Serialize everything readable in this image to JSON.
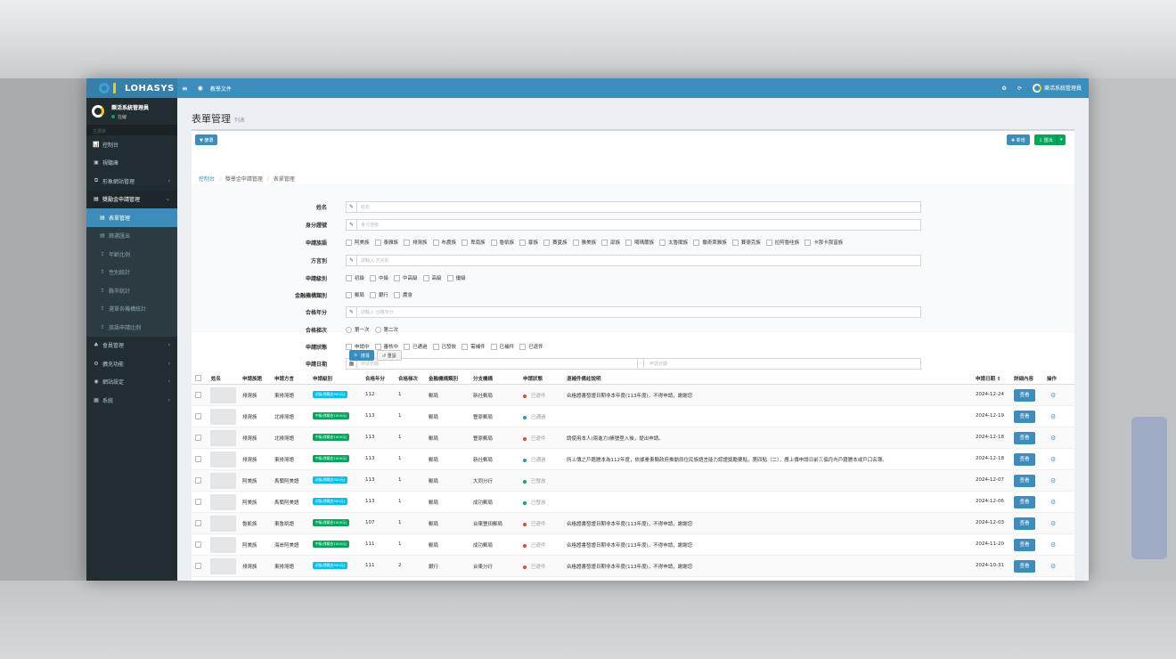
{
  "app": {
    "logo_text": "LOHASYS",
    "docs_link": "教學文件",
    "user_name": "樂活系統管理員",
    "user_status": "在線",
    "menu_header": "主選單"
  },
  "sidebar": {
    "items": [
      {
        "icon": "chart-icon",
        "glyph": "📊",
        "label": "控制台",
        "type": "top"
      },
      {
        "icon": "file-icon",
        "glyph": "▣",
        "label": "視聽庫",
        "type": "top"
      },
      {
        "icon": "clone-icon",
        "glyph": "⧉",
        "label": "形象網站管理",
        "type": "top",
        "chevron": "‹"
      },
      {
        "icon": "list-icon",
        "glyph": "▤",
        "label": "獎勵金申請管理",
        "type": "open",
        "chevron": "⌄"
      },
      {
        "icon": "file-icon",
        "glyph": "▤",
        "label": "表單管理",
        "type": "active"
      },
      {
        "icon": "file-icon",
        "glyph": "▤",
        "label": "篩選匯出",
        "type": "sub"
      },
      {
        "icon": "upload-icon",
        "glyph": "⇪",
        "label": "年齡比例",
        "type": "sub"
      },
      {
        "icon": "upload-icon",
        "glyph": "⇪",
        "label": "性別統計",
        "type": "sub"
      },
      {
        "icon": "upload-icon",
        "glyph": "⇪",
        "label": "縣市統計",
        "type": "sub"
      },
      {
        "icon": "upload-icon",
        "glyph": "⇪",
        "label": "選單各機構統計",
        "type": "sub"
      },
      {
        "icon": "upload-icon",
        "glyph": "⇪",
        "label": "族語申請比例",
        "type": "sub"
      },
      {
        "icon": "user-icon",
        "glyph": "♣",
        "label": "會員管理",
        "type": "top",
        "chevron": "‹"
      },
      {
        "icon": "cogs-icon",
        "glyph": "⚙",
        "label": "擴充功能",
        "type": "top",
        "chevron": "‹"
      },
      {
        "icon": "globe-icon",
        "glyph": "◉",
        "label": "網站設定",
        "type": "top",
        "chevron": "‹"
      },
      {
        "icon": "system-icon",
        "glyph": "▦",
        "label": "系統",
        "type": "top",
        "chevron": "‹"
      }
    ]
  },
  "page": {
    "title": "表單管理",
    "subtitle": "列表",
    "filter_button": "▼ 篩選",
    "add_button": "✚ 新增",
    "export_button": "⇩ 匯出",
    "breadcrumb": [
      "控制台",
      "獎學金申請管理",
      "表單管理"
    ]
  },
  "form": {
    "name_label": "姓名",
    "name_placeholder": "姓名",
    "id_label": "身分證號",
    "id_placeholder": "身分證號",
    "tribe_label": "申請族語",
    "tribes": [
      "阿美族",
      "泰雅族",
      "排灣族",
      "布農族",
      "卑南族",
      "魯凱族",
      "鄒族",
      "賽夏族",
      "雅美族",
      "邵族",
      "噶瑪蘭族",
      "太魯閣族",
      "撒奇萊雅族",
      "賽德克族",
      "拉阿魯哇族",
      "卡那卡那富族"
    ],
    "dialect_label": "方言別",
    "dialect_placeholder": "請輸入 方言別",
    "level_label": "申請級別",
    "levels": [
      "初級",
      "中級",
      "中高級",
      "高級",
      "優級"
    ],
    "bank_label": "金融機構類別",
    "banks": [
      "郵局",
      "銀行",
      "農會"
    ],
    "year_label": "合格年分",
    "year_placeholder": "請輸入 合格年分",
    "times_label": "合格梯次",
    "times": [
      "第一次",
      "第二次"
    ],
    "status_label": "申請狀態",
    "statuses": [
      "申請中",
      "審核中",
      "已通過",
      "已發放",
      "需補件",
      "已補件",
      "已退件"
    ],
    "date_label": "申請日期",
    "date_start_placeholder": "申請日期",
    "date_sep": "-",
    "date_end_placeholder": "申請日期",
    "search_button": "🔍 搜尋",
    "reset_button": "↺ 重設"
  },
  "table": {
    "headers": [
      "姓名",
      "申請族語",
      "申請方言",
      "申請級別",
      "合格年分",
      "合格梯次",
      "金融機構類別",
      "分支機構",
      "申請狀態",
      "退補件備註說明",
      "申請日期 ⇕",
      "詳細內容",
      "操作"
    ],
    "view_label": "查看",
    "rows": [
      {
        "tribe": "排灣族",
        "dialect": "東排灣語",
        "level": "初級(獎勵金500元)",
        "level_color": "#00c0ef",
        "year": "112",
        "times": "1",
        "bank": "郵局",
        "branch": "新社郵局",
        "status": "已退件",
        "status_color": "#dd4b39",
        "note": "合格證書發證日期非本年度(113年度)，不得申請，謝謝您",
        "date": "2024-12-24"
      },
      {
        "tribe": "排灣族",
        "dialect": "北排灣語",
        "level": "中級(獎勵金1000元)",
        "level_color": "#00a65a",
        "year": "113",
        "times": "1",
        "bank": "郵局",
        "branch": "豐原郵局",
        "status": "已通過",
        "status_color": "#3c8dbc",
        "note": "",
        "date": "2024-12-19"
      },
      {
        "tribe": "排灣族",
        "dialect": "北排灣語",
        "level": "中級(獎勵金1000元)",
        "level_color": "#00a65a",
        "year": "113",
        "times": "1",
        "bank": "郵局",
        "branch": "豐原郵局",
        "status": "已退件",
        "status_color": "#dd4b39",
        "note": "請使用本人(兩進力)帳號登入後，提出申請。",
        "date": "2024-12-18"
      },
      {
        "tribe": "排灣族",
        "dialect": "東排灣語",
        "level": "中級(獎勵金1000元)",
        "level_color": "#00a65a",
        "year": "113",
        "times": "1",
        "bank": "郵局",
        "branch": "新社郵局",
        "status": "已通過",
        "status_color": "#3c8dbc",
        "note": "所上傳之戶籍謄本為112年度，依據臺東縣政府推動原住民族語言能力認證獎勵要點，第四點（二），應上傳申請日前三個月內戶籍謄本或戶口名簿。",
        "date": "2024-12-18"
      },
      {
        "tribe": "阿美族",
        "dialect": "馬蘭阿美語",
        "level": "初級(獎勵金500元)",
        "level_color": "#00c0ef",
        "year": "113",
        "times": "1",
        "bank": "郵局",
        "branch": "大同分行",
        "status": "已發放",
        "status_color": "#00a65a",
        "note": "",
        "date": "2024-12-07"
      },
      {
        "tribe": "阿美族",
        "dialect": "馬蘭阿美語",
        "level": "初級(獎勵金500元)",
        "level_color": "#00c0ef",
        "year": "113",
        "times": "1",
        "bank": "郵局",
        "branch": "成功郵局",
        "status": "已發放",
        "status_color": "#00a65a",
        "note": "",
        "date": "2024-12-06"
      },
      {
        "tribe": "魯凱族",
        "dialect": "東魯凱語",
        "level": "中級(獎勵金1000元)",
        "level_color": "#00a65a",
        "year": "107",
        "times": "1",
        "bank": "郵局",
        "branch": "台東豐田郵局",
        "status": "已退件",
        "status_color": "#dd4b39",
        "note": "合格證書發證日期非本年度(113年度)，不得申請，謝謝您",
        "date": "2024-12-03"
      },
      {
        "tribe": "阿美族",
        "dialect": "海岸阿美語",
        "level": "中級(獎勵金1000元)",
        "level_color": "#00a65a",
        "year": "111",
        "times": "1",
        "bank": "郵局",
        "branch": "成功郵局",
        "status": "已退件",
        "status_color": "#dd4b39",
        "note": "合格證書發證日期非本年度(113年度)，不得申請，謝謝您",
        "date": "2024-11-20"
      },
      {
        "tribe": "排灣族",
        "dialect": "東排灣語",
        "level": "初級(獎勵金500元)",
        "level_color": "#00c0ef",
        "year": "111",
        "times": "2",
        "bank": "銀行",
        "branch": "台東分行",
        "status": "已退件",
        "status_color": "#dd4b39",
        "note": "合格證書發證日期非本年度(113年度)，不得申請，謝謝您",
        "date": "2024-10-31"
      }
    ]
  }
}
